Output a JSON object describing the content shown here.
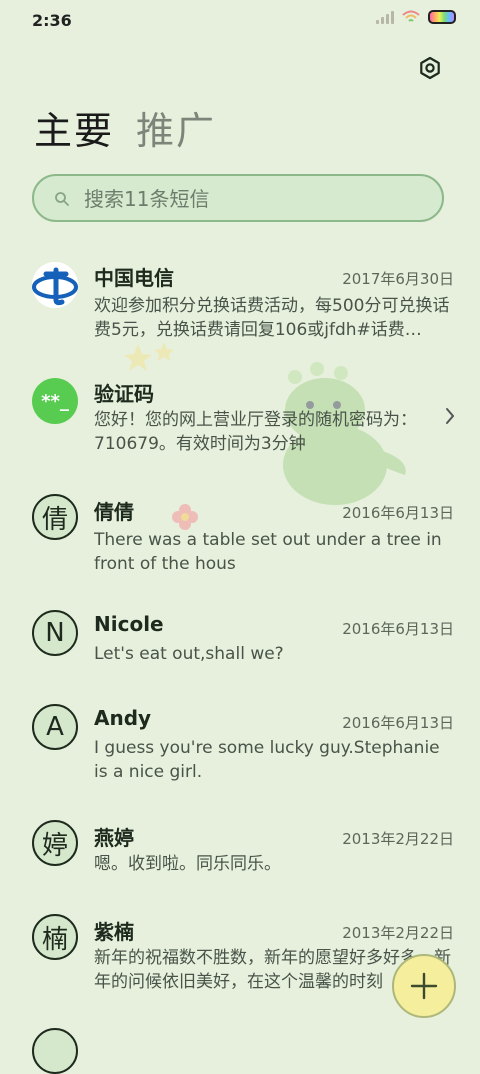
{
  "status": {
    "time": "2:36"
  },
  "tabs": [
    {
      "label": "主要"
    },
    {
      "label": "推广"
    }
  ],
  "search": {
    "placeholder": "搜索11条短信"
  },
  "messages": [
    {
      "avatar": "logo",
      "name": "中国电信",
      "date": "2017年6月30日",
      "preview": "欢迎参加积分兑换话费活动，每500分可兑换话费5元，兑换话费请回复106或jfdh#话费…"
    },
    {
      "avatar": "**_",
      "name": "验证码",
      "date": "",
      "preview": "您好！您的网上营业厅登录的随机密码为：710679。有效时间为3分钟"
    },
    {
      "avatar": "倩",
      "name": "倩倩",
      "date": "2016年6月13日",
      "preview": "There was a table set out under a tree in front of the hous"
    },
    {
      "avatar": "N",
      "name": "Nicole",
      "date": "2016年6月13日",
      "preview": "Let's eat out,shall we?"
    },
    {
      "avatar": "A",
      "name": "Andy",
      "date": "2016年6月13日",
      "preview": "I guess you're some lucky guy.Stephanie is a nice girl."
    },
    {
      "avatar": "婷",
      "name": "燕婷",
      "date": "2013年2月22日",
      "preview": "嗯。收到啦。同乐同乐。"
    },
    {
      "avatar": "楠",
      "name": "紫楠",
      "date": "2013年2月22日",
      "preview": "新年的祝福数不胜数，新年的愿望好多好多，新年的问候依旧美好，在这个温馨的时刻"
    },
    {
      "avatar": "",
      "name": "",
      "date": "",
      "preview": ""
    }
  ],
  "icons": {
    "settings": "gear-icon",
    "search": "search-icon",
    "chevron": "chevron-right-icon",
    "fab": "plus-icon"
  },
  "colors": {
    "background": "#e6f0dc",
    "search_border": "#8db88a",
    "fab": "#f4ee9d",
    "verify_avatar": "#58cc50",
    "telecom_blue": "#1560b8"
  }
}
